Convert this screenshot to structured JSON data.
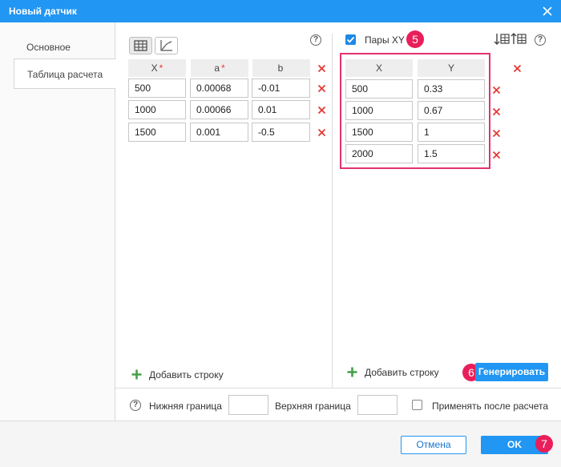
{
  "window": {
    "title": "Новый датчик"
  },
  "tabs": [
    {
      "label": "Основное"
    },
    {
      "label": "Таблица расчета"
    }
  ],
  "left_table": {
    "headers": [
      {
        "label": "X",
        "required": "*"
      },
      {
        "label": "a",
        "required": "*"
      },
      {
        "label": "b",
        "required": ""
      }
    ],
    "rows": [
      [
        "500",
        "0.00068",
        "-0.01"
      ],
      [
        "1000",
        "0.00066",
        "0.01"
      ],
      [
        "1500",
        "0.001",
        "-0.5"
      ]
    ],
    "add_row_label": "Добавить строку"
  },
  "xy_pairs": {
    "checkbox_label": "Пары XY",
    "checked": true,
    "headers": [
      "X",
      "Y"
    ],
    "rows": [
      [
        "500",
        "0.33"
      ],
      [
        "1000",
        "0.67"
      ],
      [
        "1500",
        "1"
      ],
      [
        "2000",
        "1.5"
      ]
    ],
    "add_row_label": "Добавить строку",
    "generate_label": "Генерировать"
  },
  "bounds": {
    "lower_label": "Нижняя граница",
    "lower_value": "",
    "upper_label": "Верхняя граница",
    "upper_value": "",
    "apply_after_label": "Применять после расчета",
    "apply_after_checked": false
  },
  "help_glyph": "?",
  "badges": [
    "5",
    "6",
    "7"
  ],
  "footer": {
    "cancel_label": "Отмена",
    "ok_label": "OK"
  },
  "colors": {
    "accent": "#2196f3",
    "delete": "#e53935",
    "highlight": "#e2336d",
    "add": "#43a047"
  },
  "icons": [
    "close-icon",
    "table-view-icon",
    "chart-view-icon",
    "help-icon",
    "delete-icon",
    "plus-icon",
    "sort-down-icon",
    "sort-up-icon"
  ]
}
